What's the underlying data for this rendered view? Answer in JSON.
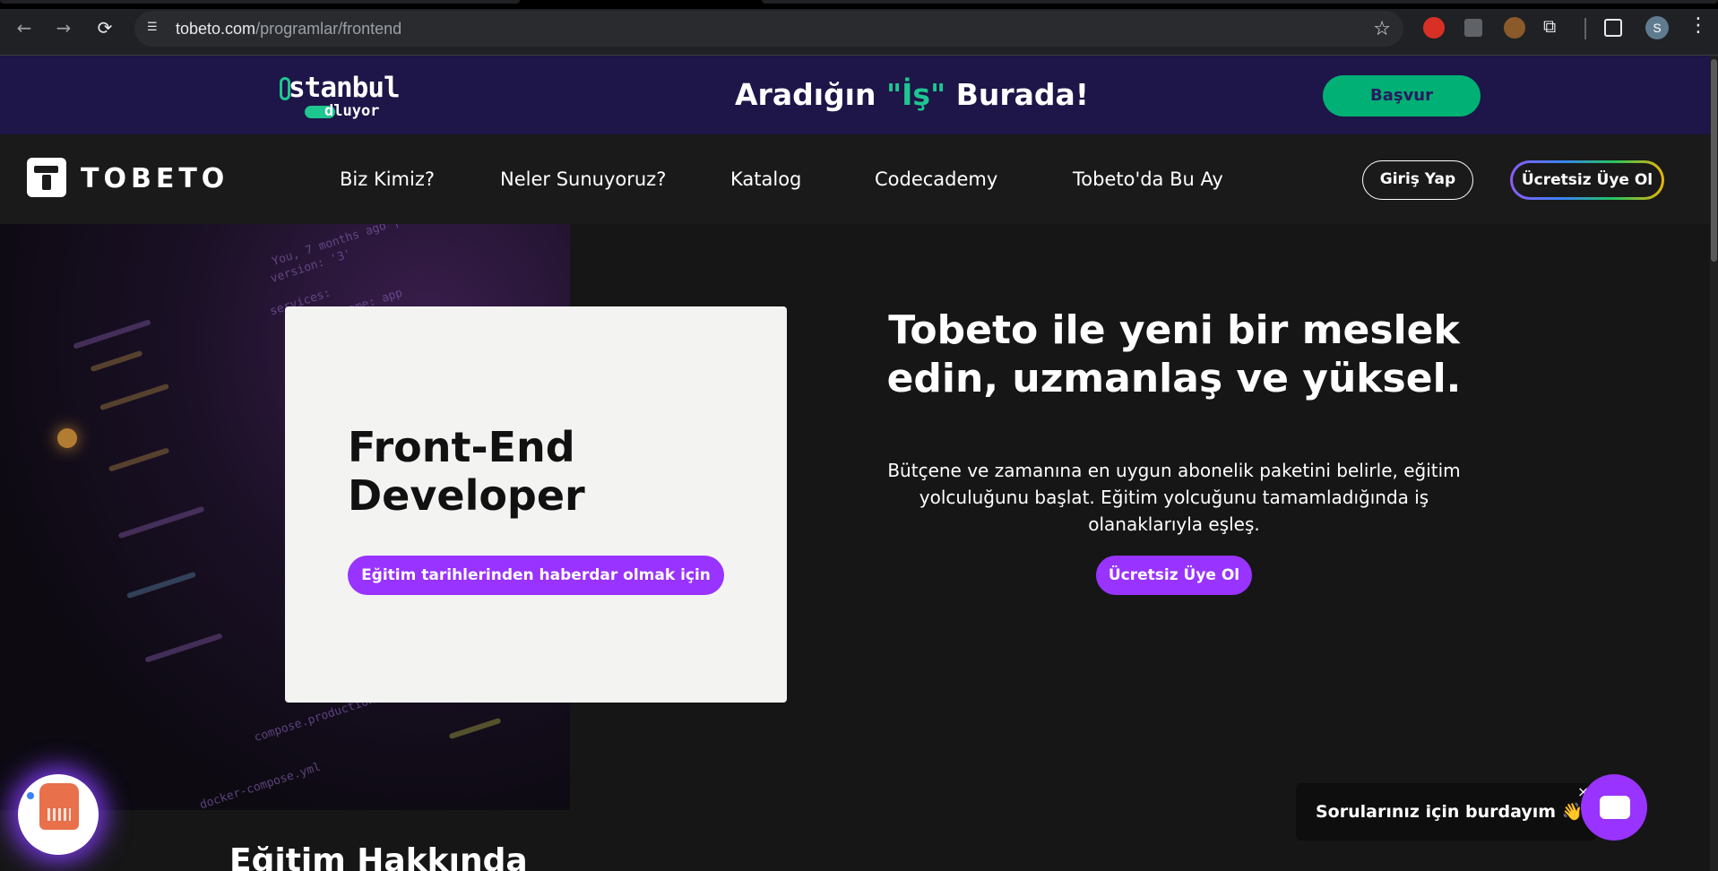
{
  "browser": {
    "url_host": "tobeto.com",
    "url_path": "/programlar/frontend",
    "avatar_letter": "S"
  },
  "promo": {
    "logo_line1": "stanbul",
    "logo_line2": "dluyor",
    "title_before": "Aradığın ",
    "title_highlight": "\"İş\"",
    "title_after": " Burada!",
    "apply_label": "Başvur",
    "accent_color": "#1ec690",
    "bg_color": "#1e1548"
  },
  "nav": {
    "brand": "TOBETO",
    "links": [
      "Biz Kimiz?",
      "Neler Sunuyoruz?",
      "Katalog",
      "Codecademy",
      "Tobeto'da Bu Ay"
    ],
    "login_label": "Giriş Yap",
    "signup_label": "Ücretsiz Üye Ol"
  },
  "hero": {
    "card_title": "Front-End Developer",
    "card_button": "Eğitim tarihlerinden haberdar olmak için",
    "headline": "Tobeto ile yeni bir meslek edin, uzmanlaş ve yüksel.",
    "description": "Bütçene ve zamanına en uygun abonelik paketini belirle, eğitim yolculuğunu başlat. Eğitim yolcuğunu tamamladığında iş olanaklarıyla eşleş.",
    "cta_label": "Ücretsiz Üye Ol",
    "accent_color": "#9933ff"
  },
  "section": {
    "title": "Eğitim Hakkında"
  },
  "chat": {
    "message": "Sorularınız için burdayım 👋",
    "close": "×"
  },
  "icons": {
    "back": "←",
    "forward": "→",
    "reload": "⟳",
    "site_info": "☰",
    "star": "☆",
    "puzzle": "⧉",
    "menu": "⋮"
  }
}
